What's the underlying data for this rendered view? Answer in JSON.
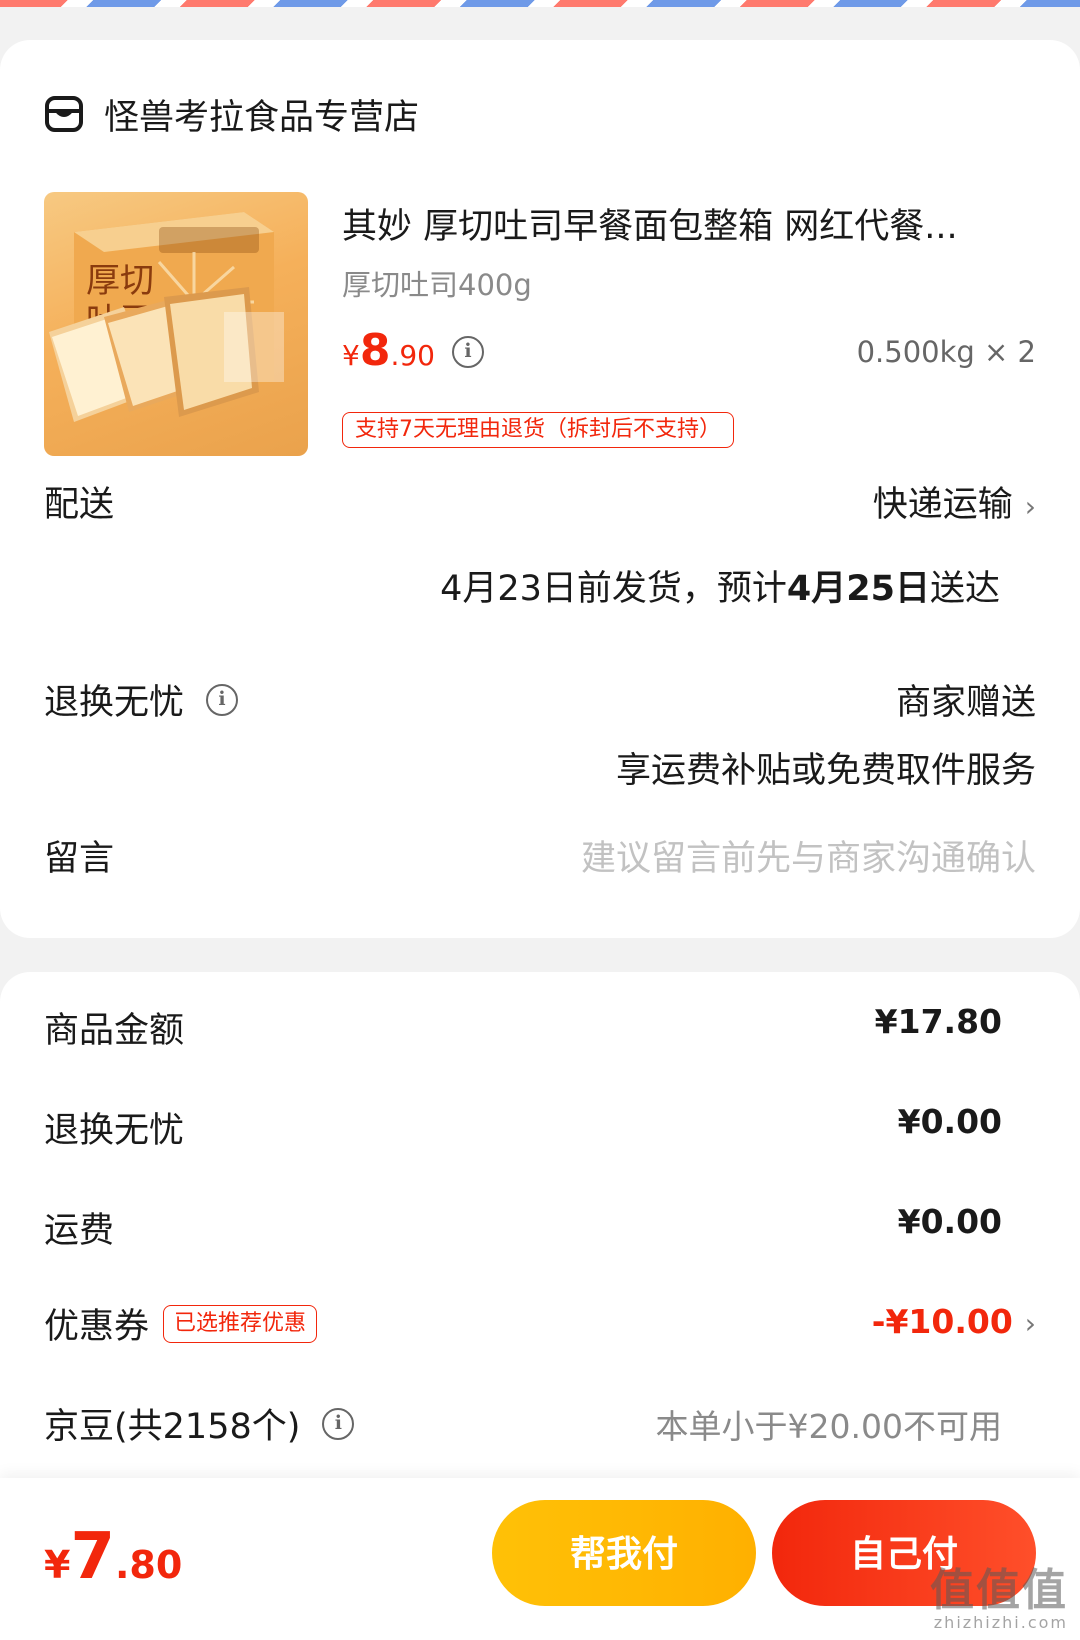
{
  "store": {
    "name": "怪兽考拉食品专营店",
    "icon": "store-icon"
  },
  "product": {
    "title": "其妙 厚切吐司早餐面包整箱 网红代餐...",
    "spec": "厚切吐司400g",
    "price_currency": "¥",
    "price_int": "8",
    "price_dec": ".90",
    "qty": "0.500kg × 2",
    "return_tag": "支持7天无理由退货（拆封后不支持）",
    "image_text_1": "厚切",
    "image_text_2": "吐司"
  },
  "shipping": {
    "label": "配送",
    "method": "快递运输",
    "detail_pre": "4月23日前发货，预计",
    "detail_bold": "4月25日",
    "detail_post": "送达"
  },
  "worry_free": {
    "label": "退换无忧",
    "value": "商家赠送",
    "desc": "享运费补贴或免费取件服务"
  },
  "message": {
    "label": "留言",
    "placeholder": "建议留言前先与商家沟通确认"
  },
  "costs": {
    "goods_label": "商品金额",
    "goods_value": "¥17.80",
    "worry_label": "退换无忧",
    "worry_value": "¥0.00",
    "freight_label": "运费",
    "freight_value": "¥0.00",
    "coupon_label": "优惠券",
    "coupon_tag": "已选推荐优惠",
    "coupon_value": "-¥10.00",
    "jingdou_label": "京豆(共2158个)",
    "jingdou_value": "本单小于¥20.00不可用"
  },
  "bottom": {
    "total_currency": "¥",
    "total_int": "7",
    "total_dec": ".80",
    "help_pay": "帮我付",
    "self_pay": "自己付"
  },
  "watermark": {
    "top": "值值值",
    "bottom": "zhizhizhi.com"
  },
  "colors": {
    "accent_red": "#f2270c",
    "accent_yellow": "#ffb000",
    "muted": "#8a8a8a"
  }
}
